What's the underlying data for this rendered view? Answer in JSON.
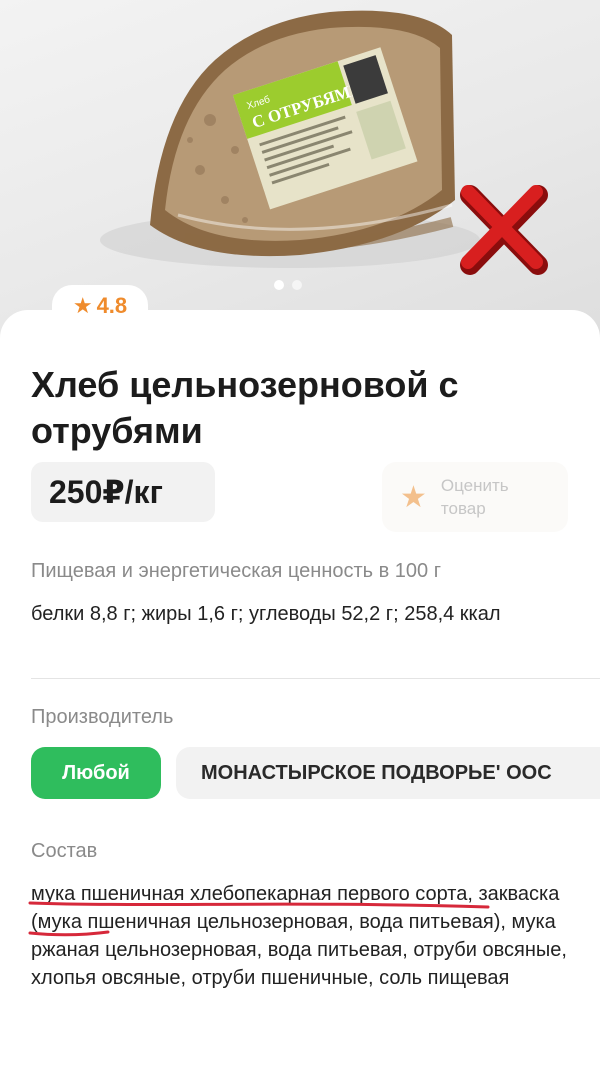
{
  "product": {
    "title": "Хлеб цельнозерновой с отрубями",
    "price": "250₽/кг",
    "rating": "4.8",
    "rate_button_label": "Оценить товар",
    "package_label": {
      "line1": "Хлеб",
      "line2": "С ОТРУБЯМИ"
    }
  },
  "gallery": {
    "slides": 2,
    "active_slide": 1
  },
  "nutrition": {
    "label": "Пищевая и энергетическая ценность в 100 г",
    "value": "белки 8,8 г; жиры 1,6 г; углеводы 52,2 г; 258,4 ккал"
  },
  "manufacturer": {
    "label": "Производитель",
    "options": [
      "Любой",
      "МОНАСТЫРСКОЕ ПОДВОРЬЕ' ООС"
    ],
    "selected": "Любой"
  },
  "composition": {
    "label": "Состав",
    "text": "мука пшеничная хлебопекарная первого сорта, закваска (мука пшеничная цельнозерновая, вода питьевая), мука ржаная цельнозерновая, вода питьевая, отруби овсяные, хлопья овсяные, отруби пшеничные, соль пищевая"
  },
  "colors": {
    "accent_green": "#2fbd5d",
    "rating_orange": "#ef8b2c",
    "cross_red": "#d81f1f",
    "underline_red": "#d6283a"
  },
  "icons": [
    "star-icon",
    "cross-mark-icon"
  ]
}
